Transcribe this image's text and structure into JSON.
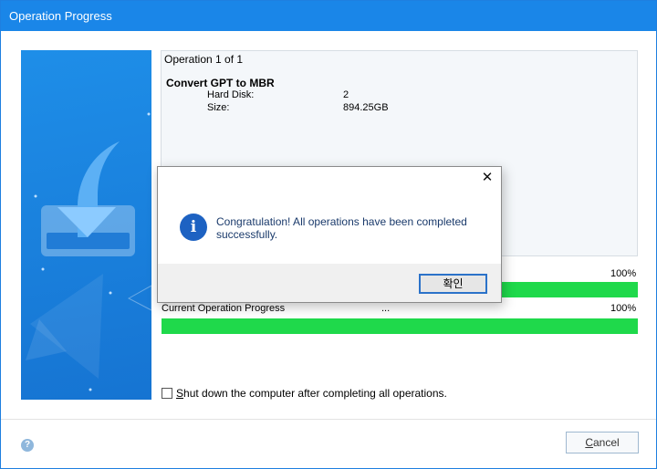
{
  "window": {
    "title": "Operation Progress"
  },
  "operation": {
    "count_label": "Operation 1 of 1",
    "name": "Convert GPT to MBR",
    "details": [
      {
        "label": "Hard Disk:",
        "value": "2"
      },
      {
        "label": "Size:",
        "value": "894.25GB"
      }
    ]
  },
  "overall_progress": {
    "percent_label": "100%",
    "value": 1.0
  },
  "current_progress": {
    "label": "Current Operation Progress",
    "status": "...",
    "percent_label": "100%",
    "value": 1.0
  },
  "shutdown_option": {
    "label": "Shut down the computer after completing all operations.",
    "checked": false
  },
  "footer": {
    "help_icon": "?",
    "cancel_label": "Cancel"
  },
  "dialog": {
    "close_glyph": "✕",
    "icon": "i",
    "message": "Congratulation! All operations have been completed successfully.",
    "ok_label": "확인"
  },
  "colors": {
    "title_bar": "#1a86e8",
    "progress_fill": "#1fd94b",
    "dialog_icon": "#1d62c2"
  }
}
